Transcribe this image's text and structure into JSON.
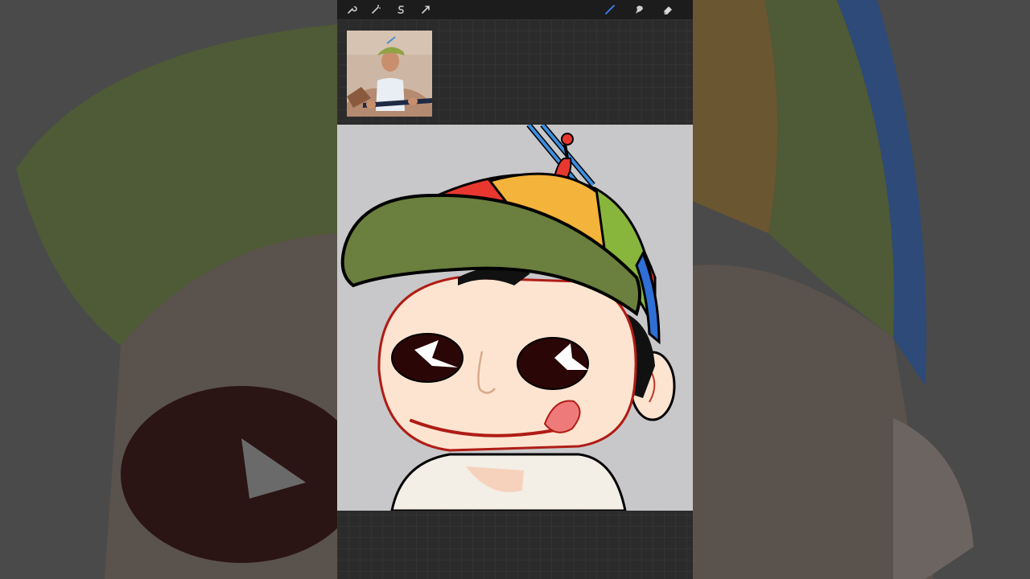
{
  "toolbar": {
    "left_tools": [
      {
        "name": "wrench-icon"
      },
      {
        "name": "adjustments-wand-icon"
      },
      {
        "name": "selection-s-icon"
      },
      {
        "name": "transform-arrow-icon"
      }
    ],
    "right_tools": [
      {
        "name": "brush-icon",
        "active": true
      },
      {
        "name": "smudge-icon"
      },
      {
        "name": "eraser-icon"
      }
    ]
  },
  "colors": {
    "toolbar_bg": "#1c1c1c",
    "canvas_area_bg": "#2b2b2b",
    "artwork_bg": "#c8c8ca",
    "active_tool": "#3b82f6",
    "cap_green": "#6b7f3e",
    "cap_yellow": "#f4b33a",
    "cap_red": "#e8372f",
    "cap_blue": "#2f6fd6",
    "skin": "#fde4d0"
  }
}
